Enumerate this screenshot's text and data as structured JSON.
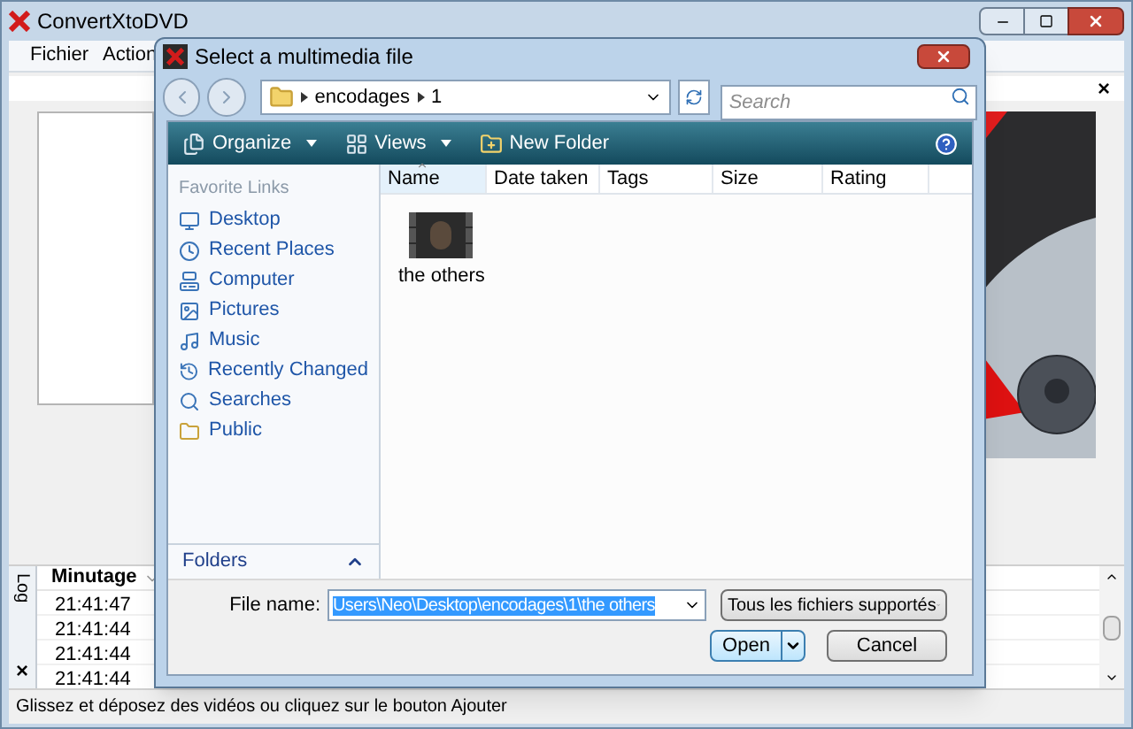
{
  "main_window": {
    "title": "ConvertXtoDVD",
    "menu": [
      "Fichier",
      "Action"
    ],
    "panel_close": "×"
  },
  "dialog": {
    "title": "Select a multimedia file",
    "breadcrumb": [
      "encodages",
      "1"
    ],
    "search": {
      "placeholder": "Search"
    },
    "toolbar": [
      {
        "label": "Organize",
        "kind": "menu"
      },
      {
        "label": "Views",
        "kind": "menu"
      },
      {
        "label": "New Folder",
        "kind": "button"
      }
    ],
    "favorite_links": {
      "title": "Favorite Links",
      "items": [
        "Desktop",
        "Recent Places",
        "Computer",
        "Pictures",
        "Music",
        "Recently Changed",
        "Searches",
        "Public"
      ]
    },
    "folders": "Folders",
    "columns": [
      {
        "label": "Name",
        "sorted": true
      },
      {
        "label": "Date taken",
        "sorted": false
      },
      {
        "label": "Tags",
        "sorted": false
      },
      {
        "label": "Size",
        "sorted": false
      },
      {
        "label": "Rating",
        "sorted": false
      }
    ],
    "files": [
      "the others"
    ],
    "file_name": {
      "label": "File name:",
      "value": "Users\\Neo\\Desktop\\encodages\\1\\the others"
    },
    "file_type": "Tous les fichiers supportés",
    "buttons": [
      {
        "label": "Open",
        "kind": "split"
      },
      {
        "label": "Cancel",
        "kind": "plain"
      }
    ]
  },
  "log": {
    "tab": "Log",
    "close": "×",
    "column": {
      "label": "Minutage",
      "sorted": true
    },
    "rows": [
      "21:41:47",
      "21:41:44",
      "21:41:44",
      "21:41:44"
    ]
  },
  "status_bar": "Glissez et déposez des vidéos ou cliquez sur le bouton Ajouter"
}
